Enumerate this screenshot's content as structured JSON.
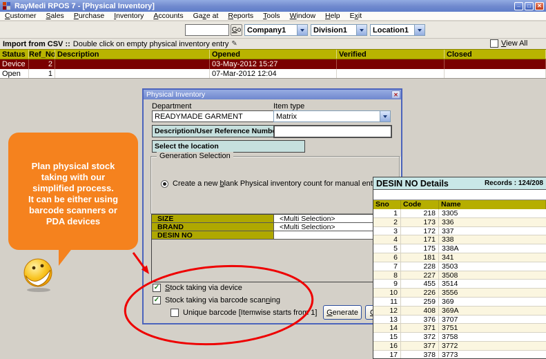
{
  "colors": {
    "bubble_orange": "#F5821E",
    "annotation_red": "#EE0000",
    "header_olive": "#B9B400",
    "selected_row_maroon": "#7A0000",
    "panel_header_teal": "#C9E7E7",
    "teal_button": "#C6E0DE",
    "titlebar_blue": "#7089CE"
  },
  "icons": {
    "check": "✓",
    "close_x": "✕",
    "minimize": "_",
    "maximize": "□",
    "pencil": "✎"
  },
  "window": {
    "title": "RayMedi RPOS 7 - [Physical Inventory]"
  },
  "menu": {
    "items": [
      {
        "label": "Customer",
        "u": 0
      },
      {
        "label": "Sales",
        "u": 0
      },
      {
        "label": "Purchase",
        "u": 0
      },
      {
        "label": "Inventory",
        "u": 0
      },
      {
        "label": "Accounts",
        "u": 0
      },
      {
        "label": "Gaze at",
        "u": 2
      },
      {
        "label": "Reports",
        "u": 0
      },
      {
        "label": "Tools",
        "u": 0
      },
      {
        "label": "Window",
        "u": 0
      },
      {
        "label": "Help",
        "u": 0
      },
      {
        "label": "Exit",
        "u": 1
      }
    ]
  },
  "toolbar": {
    "search_value": "",
    "go_button": {
      "label": "Go",
      "u": 0
    },
    "company_select": "Company1",
    "division_select": "Division1",
    "location_select": "Location1"
  },
  "csv_bar": {
    "bold_text": "Import from CSV ::",
    "text": "Double click on empty physical inventory entry",
    "view_all": {
      "label": "View All",
      "u": 0,
      "checked": false
    }
  },
  "inventory_table": {
    "columns": [
      "Status",
      "Ref_No",
      "Description",
      "Opened",
      "Verified",
      "Closed"
    ],
    "rows": [
      {
        "status": "Device",
        "ref_no": "2",
        "description": "",
        "opened": "03-May-2012 15:27",
        "verified": "",
        "closed": ""
      },
      {
        "status": "Open",
        "ref_no": "1",
        "description": "",
        "opened": "07-Mar-2012 12:04",
        "verified": "",
        "closed": ""
      }
    ]
  },
  "bubble": {
    "lines": [
      "Plan physical stock",
      "taking with our",
      "simplified process.",
      "It can be either using",
      "barcode scanners or",
      "PDA devices"
    ]
  },
  "dialog": {
    "title": "Physical Inventory",
    "department_label": "Department",
    "department_value": "READYMADE GARMENT",
    "item_type_label": "Item type",
    "item_type_value": "Matrix",
    "description_button": "Description/User Reference Number",
    "reference_value": "",
    "location_button": "Select the location",
    "generation_group_label": "Generation Selection",
    "radio_option": {
      "label": "Create a new blank Physical inventory count for manual entry",
      "u": 13,
      "selected": true
    },
    "selection_grid": [
      {
        "label": "SIZE",
        "value": "<Multi Selection>"
      },
      {
        "label": "BRAND",
        "value": "<Multi Selection>"
      },
      {
        "label": "DESIN NO",
        "value": ""
      }
    ],
    "checkboxes": [
      {
        "label": "Stock taking via device",
        "u": 0,
        "checked": true
      },
      {
        "label": "Stock taking via barcode scanning",
        "u": 29,
        "checked": true
      },
      {
        "label": "Unique barcode [Itemwise starts from 1]",
        "u": null,
        "checked": false
      }
    ],
    "generate_button": {
      "label": "Generate",
      "u": 0
    },
    "partial_button": {
      "label": "C",
      "u": 0
    }
  },
  "desin_panel": {
    "title": "DESIN NO Details",
    "records": "Records : 124/208",
    "columns": [
      "Sno",
      "Code",
      "Name"
    ],
    "rows": [
      {
        "sno": "1",
        "code": "218",
        "name": "3305"
      },
      {
        "sno": "2",
        "code": "173",
        "name": "336"
      },
      {
        "sno": "3",
        "code": "172",
        "name": "337"
      },
      {
        "sno": "4",
        "code": "171",
        "name": "338"
      },
      {
        "sno": "5",
        "code": "175",
        "name": "338A"
      },
      {
        "sno": "6",
        "code": "181",
        "name": "341"
      },
      {
        "sno": "7",
        "code": "228",
        "name": "3503"
      },
      {
        "sno": "8",
        "code": "227",
        "name": "3508"
      },
      {
        "sno": "9",
        "code": "455",
        "name": "3514"
      },
      {
        "sno": "10",
        "code": "226",
        "name": "3556"
      },
      {
        "sno": "11",
        "code": "259",
        "name": "369"
      },
      {
        "sno": "12",
        "code": "408",
        "name": "369A"
      },
      {
        "sno": "13",
        "code": "376",
        "name": "3707"
      },
      {
        "sno": "14",
        "code": "371",
        "name": "3751"
      },
      {
        "sno": "15",
        "code": "372",
        "name": "3758"
      },
      {
        "sno": "16",
        "code": "377",
        "name": "3772"
      },
      {
        "sno": "17",
        "code": "378",
        "name": "3773"
      }
    ]
  }
}
